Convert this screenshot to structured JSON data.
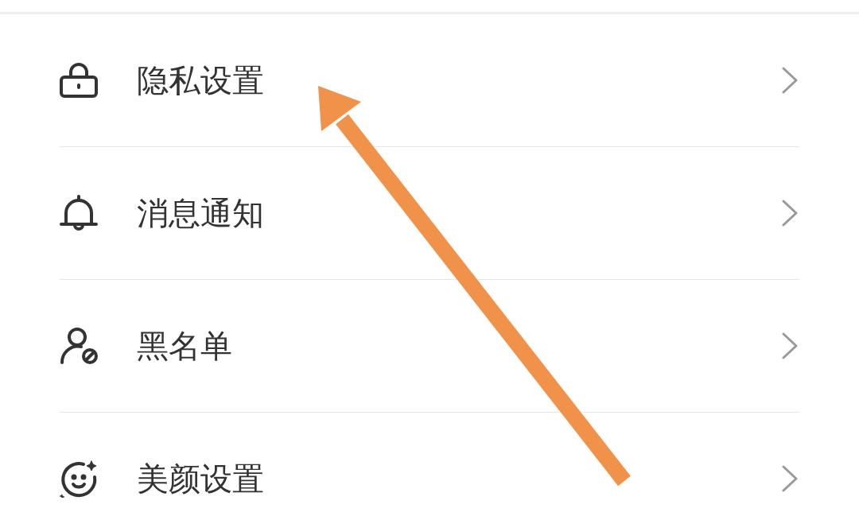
{
  "settings": {
    "items": [
      {
        "kind": "lock",
        "label": "隐私设置"
      },
      {
        "kind": "bell",
        "label": "消息通知"
      },
      {
        "kind": "blocked-user",
        "label": "黑名单"
      },
      {
        "kind": "face",
        "label": "美颜设置"
      }
    ]
  }
}
